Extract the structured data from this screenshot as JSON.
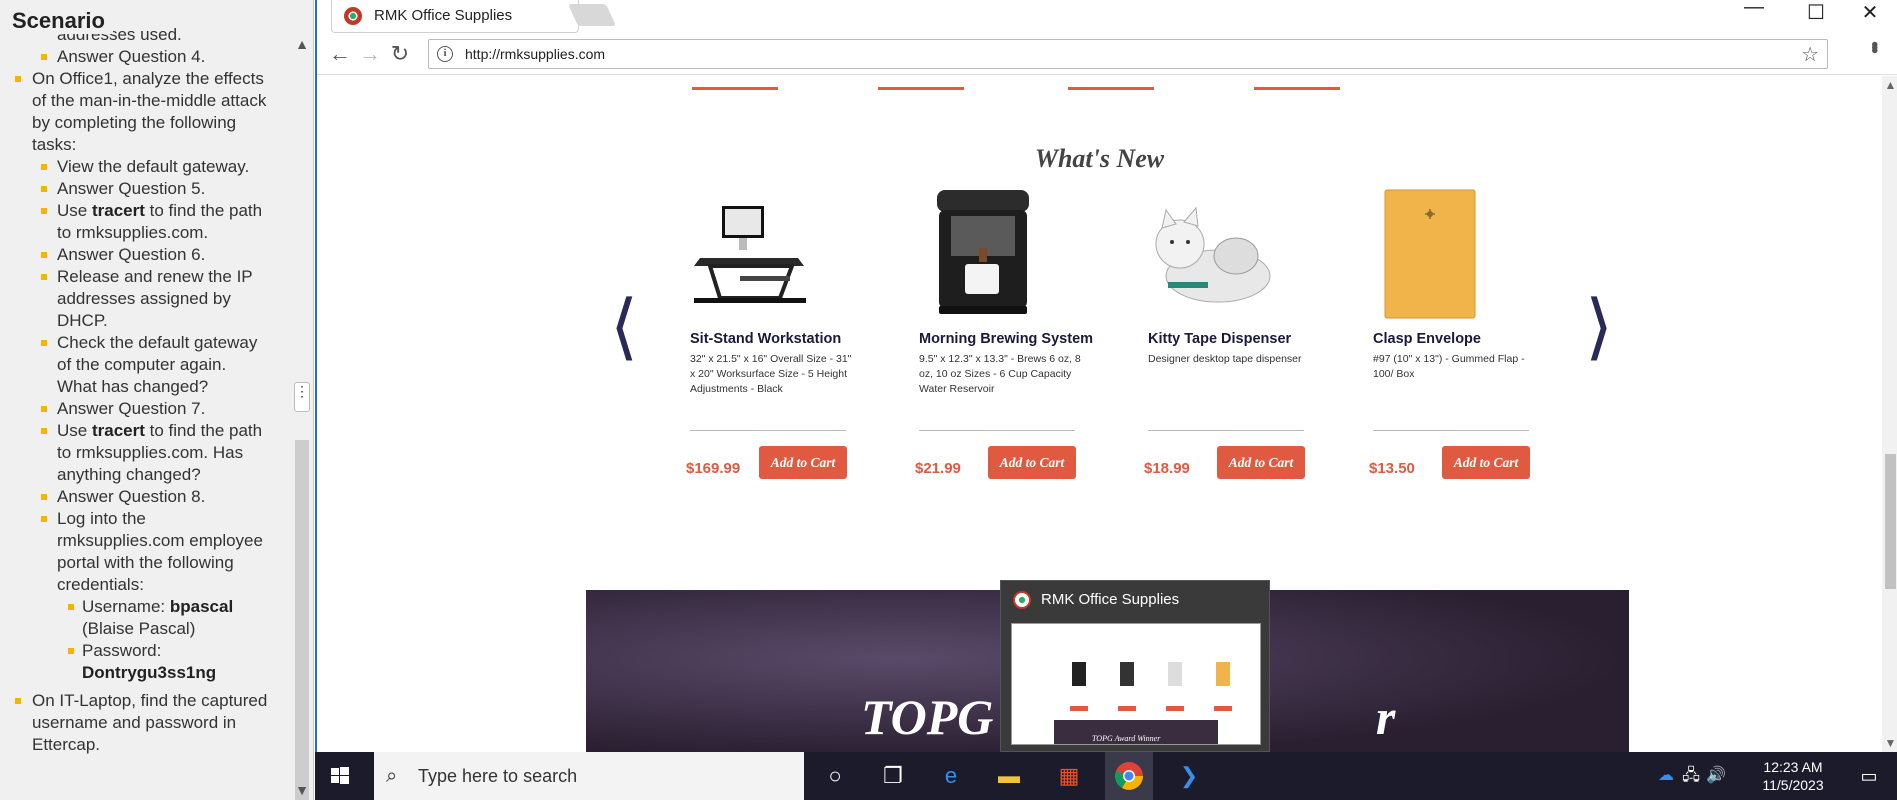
{
  "scenario": {
    "title": "Scenario",
    "lines": [
      {
        "level": 2,
        "text": "addresses used.",
        "bullet": false
      },
      {
        "level": 2,
        "text": "Answer Question 4.",
        "bullet": true
      },
      {
        "level": 1,
        "text": "On Office1, analyze the effects",
        "bullet": true
      },
      {
        "level": 1,
        "text": "of the man-in-the-middle attack",
        "bullet": false
      },
      {
        "level": 1,
        "text": "by completing the following",
        "bullet": false
      },
      {
        "level": 1,
        "text": "tasks:",
        "bullet": false
      },
      {
        "level": 2,
        "text": "View the default gateway.",
        "bullet": true
      },
      {
        "level": 2,
        "text": "Answer Question 5.",
        "bullet": true
      },
      {
        "level": 2,
        "pre": "Use ",
        "bold": "tracert",
        "post": " to find the path",
        "bullet": true
      },
      {
        "level": 2,
        "text": "to rmksupplies.com.",
        "bullet": false
      },
      {
        "level": 2,
        "text": "Answer Question 6.",
        "bullet": true
      },
      {
        "level": 2,
        "text": "Release and renew the IP",
        "bullet": true
      },
      {
        "level": 2,
        "text": "addresses assigned by",
        "bullet": false
      },
      {
        "level": 2,
        "text": "DHCP.",
        "bullet": false
      },
      {
        "level": 2,
        "text": "Check the default gateway",
        "bullet": true
      },
      {
        "level": 2,
        "text": "of the computer again.",
        "bullet": false
      },
      {
        "level": 2,
        "text": "What has changed?",
        "bullet": false
      },
      {
        "level": 2,
        "text": "Answer Question 7.",
        "bullet": true
      },
      {
        "level": 2,
        "pre": "Use ",
        "bold": "tracert",
        "post": " to find the path",
        "bullet": true
      },
      {
        "level": 2,
        "text": "to rmksupplies.com. Has",
        "bullet": false
      },
      {
        "level": 2,
        "text": "anything changed?",
        "bullet": false
      },
      {
        "level": 2,
        "text": "Answer Question 8.",
        "bullet": true
      },
      {
        "level": 2,
        "text": "Log into the",
        "bullet": true
      },
      {
        "level": 2,
        "text": "rmksupplies.com employee",
        "bullet": false
      },
      {
        "level": 2,
        "text": "portal with the following",
        "bullet": false
      },
      {
        "level": 2,
        "text": "credentials:",
        "bullet": false
      },
      {
        "level": 3,
        "pre": "Username: ",
        "bold": "bpascal",
        "post": "",
        "bullet": true
      },
      {
        "level": 3,
        "text": "(Blaise Pascal)",
        "bullet": false
      },
      {
        "level": 3,
        "text": "Password:",
        "bullet": true
      },
      {
        "level": 3,
        "pre": "",
        "bold": "Dontrygu3ss1ng",
        "post": "",
        "bullet": false
      },
      {
        "level": 0,
        "text": "",
        "bullet": false
      },
      {
        "level": 1,
        "text": "On IT-Laptop, find the captured",
        "bullet": true
      },
      {
        "level": 1,
        "text": "username and password in",
        "bullet": false
      },
      {
        "level": 1,
        "text": "Ettercap.",
        "bullet": false
      }
    ]
  },
  "browser": {
    "tab_title": "RMK Office Supplies",
    "url": "http://rmksupplies.com",
    "win_min": "—",
    "win_max": "☐",
    "win_close": "✕"
  },
  "page": {
    "section_title": "What's New",
    "add_to_cart_label": "Add to Cart",
    "products": [
      {
        "name": "Sit-Stand Workstation",
        "desc": "32\" x 21.5\" x 16\" Overall Size - 31\" x 20\" Worksurface Size - 5 Height Adjustments - Black",
        "price": "$169.99",
        "icon": "desk-image"
      },
      {
        "name": "Morning Brewing System",
        "desc": "9.5\" x 12.3\" x 13.3\" - Brews 6 oz, 8 oz, 10 oz Sizes - 6 Cup Capacity Water Reservoir",
        "price": "$21.99",
        "icon": "coffee-maker-image"
      },
      {
        "name": "Kitty Tape Dispenser",
        "desc": "Designer desktop tape dispenser",
        "price": "$18.99",
        "icon": "tape-dispenser-image"
      },
      {
        "name": "Clasp Envelope",
        "desc": "#97 (10\" x 13\") - Gummed Flap - 100/ Box",
        "price": "$13.50",
        "icon": "envelope-image"
      }
    ],
    "banner_text": "TOPG",
    "banner_text_tail": "r"
  },
  "thumbnail": {
    "title": "RMK Office Supplies",
    "mini_banner_text": "TOPG Award Winner"
  },
  "taskbar": {
    "search_placeholder": "Type here to search",
    "time": "12:23 AM",
    "date": "11/5/2023"
  },
  "colors": {
    "accent": "#e05a42",
    "navy": "#1a1a3a",
    "taskbar": "#1b1b2b"
  }
}
